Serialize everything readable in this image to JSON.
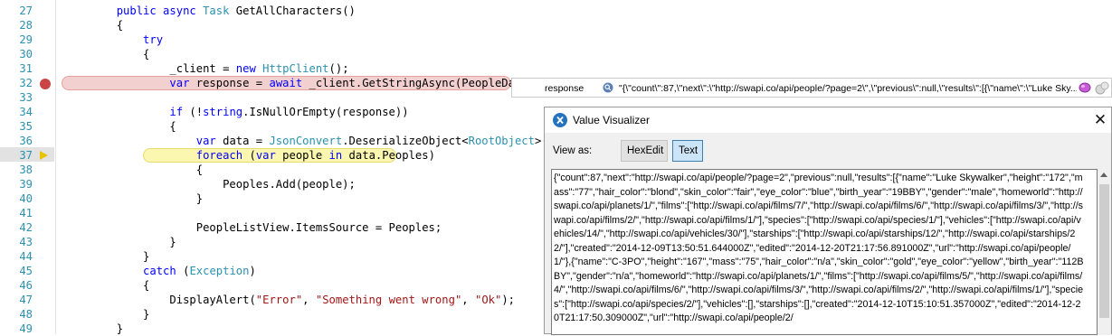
{
  "editor": {
    "lines": [
      {
        "num": "27",
        "segs": [
          [
            "k",
            "        public async "
          ],
          [
            "t",
            "Task"
          ],
          [
            "p",
            " GetAllCharacters()"
          ]
        ]
      },
      {
        "num": "28",
        "segs": [
          [
            "p",
            "        {"
          ]
        ]
      },
      {
        "num": "29",
        "segs": [
          [
            "k",
            "            try"
          ]
        ]
      },
      {
        "num": "30",
        "segs": [
          [
            "p",
            "            {"
          ]
        ]
      },
      {
        "num": "31",
        "segs": [
          [
            "p",
            "                _client = "
          ],
          [
            "k",
            "new "
          ],
          [
            "t",
            "HttpClient"
          ],
          [
            "p",
            "();"
          ]
        ]
      },
      {
        "num": "32",
        "segs": [
          [
            "k",
            "                var"
          ],
          [
            "p",
            " response = "
          ],
          [
            "k",
            "await"
          ],
          [
            "p",
            " _client.GetStringAsync(PeopleDataUrl);"
          ]
        ]
      },
      {
        "num": "33",
        "segs": [
          [
            "p",
            ""
          ]
        ]
      },
      {
        "num": "34",
        "segs": [
          [
            "k",
            "                if"
          ],
          [
            "p",
            " (!"
          ],
          [
            "k",
            "string"
          ],
          [
            "p",
            ".IsNullOrEmpty(response))"
          ]
        ]
      },
      {
        "num": "35",
        "segs": [
          [
            "p",
            "                {"
          ]
        ]
      },
      {
        "num": "36",
        "segs": [
          [
            "k",
            "                    var"
          ],
          [
            "p",
            " data = "
          ],
          [
            "t",
            "JsonConvert"
          ],
          [
            "p",
            ".DeserializeObject<"
          ],
          [
            "t",
            "RootObject"
          ],
          [
            "p",
            ">(respons"
          ]
        ]
      },
      {
        "num": "37",
        "segs": [
          [
            "k",
            "                    foreach"
          ],
          [
            "p",
            " ("
          ],
          [
            "k",
            "var"
          ],
          [
            "p",
            " people "
          ],
          [
            "k",
            "in"
          ],
          [
            "p",
            " data.Peoples)"
          ]
        ]
      },
      {
        "num": "38",
        "segs": [
          [
            "p",
            "                    {"
          ]
        ]
      },
      {
        "num": "39",
        "segs": [
          [
            "p",
            "                        Peoples.Add(people);"
          ]
        ]
      },
      {
        "num": "40",
        "segs": [
          [
            "p",
            "                    }"
          ]
        ]
      },
      {
        "num": "41",
        "segs": [
          [
            "p",
            ""
          ]
        ]
      },
      {
        "num": "42",
        "segs": [
          [
            "p",
            "                    PeopleListView.ItemsSource = Peoples;"
          ]
        ]
      },
      {
        "num": "43",
        "segs": [
          [
            "p",
            "                }"
          ]
        ]
      },
      {
        "num": "44",
        "segs": [
          [
            "p",
            "            }"
          ]
        ]
      },
      {
        "num": "45",
        "segs": [
          [
            "k",
            "            catch"
          ],
          [
            "p",
            " ("
          ],
          [
            "t",
            "Exception"
          ],
          [
            "p",
            ")"
          ]
        ]
      },
      {
        "num": "46",
        "segs": [
          [
            "p",
            "            {"
          ]
        ]
      },
      {
        "num": "47",
        "segs": [
          [
            "p",
            "                DisplayAlert("
          ],
          [
            "s",
            "\"Error\""
          ],
          [
            "p",
            ", "
          ],
          [
            "s",
            "\"Something went wrong\""
          ],
          [
            "p",
            ", "
          ],
          [
            "s",
            "\"Ok\""
          ],
          [
            "p",
            ");"
          ]
        ]
      },
      {
        "num": "48",
        "segs": [
          [
            "p",
            "            }"
          ]
        ]
      },
      {
        "num": "49",
        "segs": [
          [
            "p",
            "        }"
          ]
        ]
      }
    ],
    "breakpoint_line": "32",
    "current_line": "37"
  },
  "datatip": {
    "name": "response",
    "value": "\"{\\\"count\\\":87,\\\"next\\\":\\\"http://swapi.co/api/people/?page=2\\\",\\\"previous\\\":null,\\\"results\\\":[{\\\"name\\\":\\\"Luke Sky..."
  },
  "visualizer": {
    "title": "Value Visualizer",
    "close_label": "✕",
    "view_as_label": "View as:",
    "hexedit_label": "HexEdit",
    "text_label": "Text",
    "content": "{\"count\":87,\"next\":\"http://swapi.co/api/people/?page=2\",\"previous\":null,\"results\":[{\"name\":\"Luke Skywalker\",\"height\":\"172\",\"mass\":\"77\",\"hair_color\":\"blond\",\"skin_color\":\"fair\",\"eye_color\":\"blue\",\"birth_year\":\"19BBY\",\"gender\":\"male\",\"homeworld\":\"http://swapi.co/api/planets/1/\",\"films\":[\"http://swapi.co/api/films/7/\",\"http://swapi.co/api/films/6/\",\"http://swapi.co/api/films/3/\",\"http://swapi.co/api/films/2/\",\"http://swapi.co/api/films/1/\"],\"species\":[\"http://swapi.co/api/species/1/\"],\"vehicles\":[\"http://swapi.co/api/vehicles/14/\",\"http://swapi.co/api/vehicles/30/\"],\"starships\":[\"http://swapi.co/api/starships/12/\",\"http://swapi.co/api/starships/22/\"],\"created\":\"2014-12-09T13:50:51.644000Z\",\"edited\":\"2014-12-20T21:17:56.891000Z\",\"url\":\"http://swapi.co/api/people/1/\"},{\"name\":\"C-3PO\",\"height\":\"167\",\"mass\":\"75\",\"hair_color\":\"n/a\",\"skin_color\":\"gold\",\"eye_color\":\"yellow\",\"birth_year\":\"112BBY\",\"gender\":\"n/a\",\"homeworld\":\"http://swapi.co/api/planets/1/\",\"films\":[\"http://swapi.co/api/films/5/\",\"http://swapi.co/api/films/4/\",\"http://swapi.co/api/films/6/\",\"http://swapi.co/api/films/3/\",\"http://swapi.co/api/films/2/\",\"http://swapi.co/api/films/1/\"],\"species\":[\"http://swapi.co/api/species/2/\"],\"vehicles\":[],\"starships\":[],\"created\":\"2014-12-10T15:10:51.357000Z\",\"edited\":\"2014-12-20T21:17:50.309000Z\",\"url\":\"http://swapi.co/api/people/2/"
  },
  "colors": {
    "keyword": "#0000ff",
    "type": "#2b91af",
    "string": "#a31515",
    "line_number": "#2b91af",
    "breakpoint": "#c94545",
    "current_line": "#fbf6b0"
  }
}
